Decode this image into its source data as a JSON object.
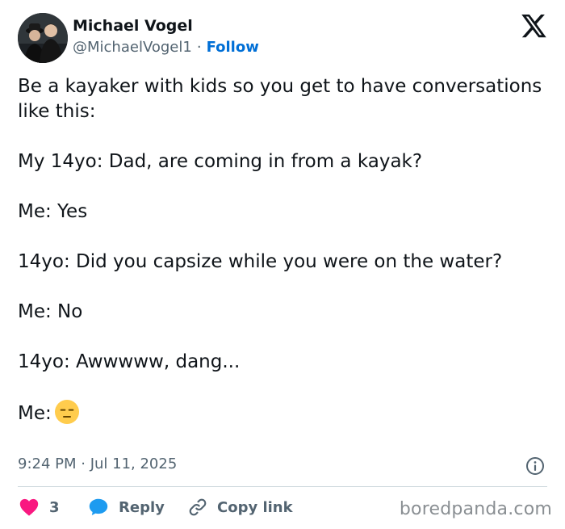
{
  "author": {
    "name": "Michael Vogel",
    "handle": "@MichaelVogel1",
    "separator": "·",
    "follow_label": "Follow"
  },
  "tweet": {
    "paragraphs": [
      "Be a kayaker with kids so you get to have conversations like this:",
      "My 14yo: Dad, are coming in from a kayak?",
      "Me: Yes",
      "14yo: Did you capsize while you were on the water?",
      "Me: No",
      "14yo: Awwwww, dang...",
      "Me:"
    ],
    "final_emoji": "expressionless-face-emoji"
  },
  "meta": {
    "timestamp": "9:24 PM · Jul 11, 2025"
  },
  "actions": {
    "like_count": "3",
    "reply_label": "Reply",
    "copy_label": "Copy link"
  },
  "watermark": "boredpanda.com",
  "icons": {
    "platform": "x-logo-icon",
    "info": "info-icon",
    "like": "heart-icon",
    "reply": "speech-bubble-icon",
    "copy": "link-icon"
  },
  "colors": {
    "text": "#0f1419",
    "secondary": "#536471",
    "follow": "#006fd6",
    "like": "#f91880",
    "reply": "#1d9bf0",
    "emoji": "#ffcc4d"
  }
}
